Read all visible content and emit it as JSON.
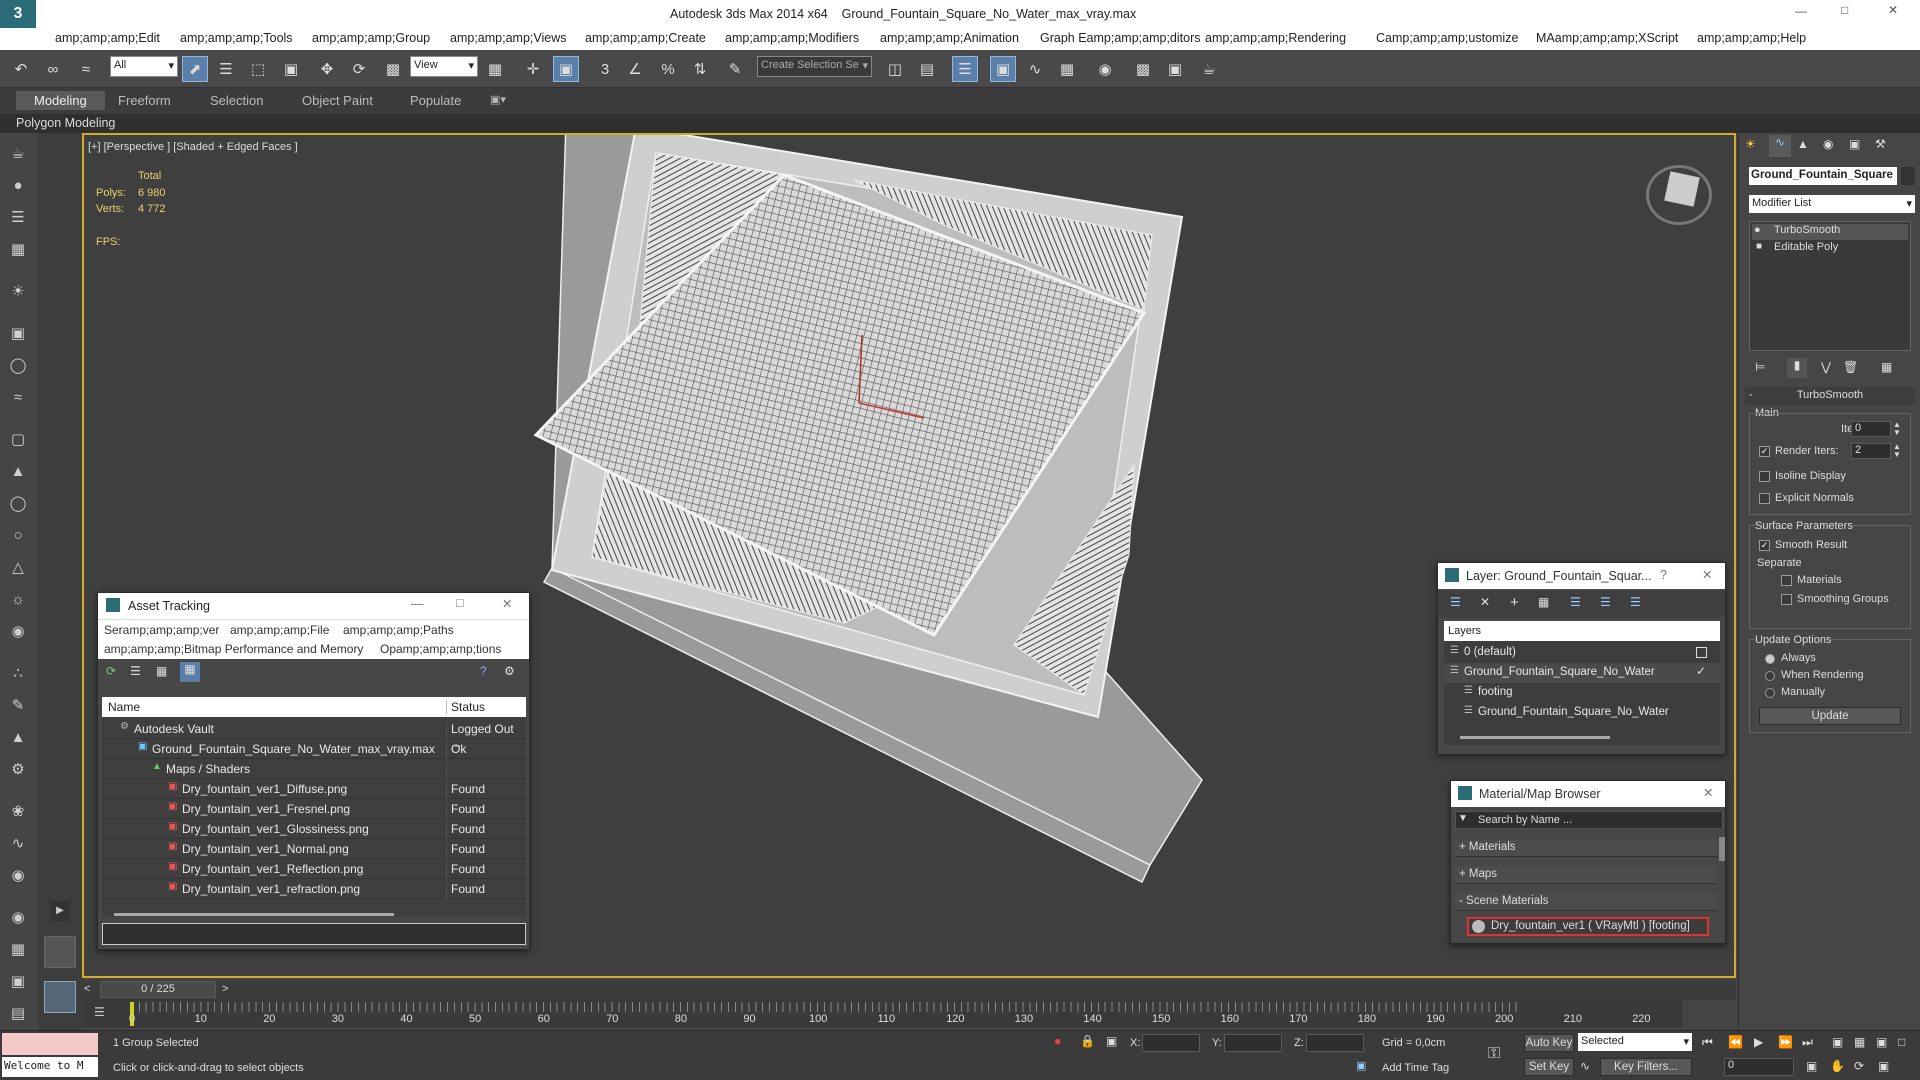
{
  "title": {
    "app": "Autodesk 3ds Max  2014 x64",
    "file": "Ground_Fountain_Square_No_Water_max_vray.max"
  },
  "menu": [
    "amp;amp;amp;Edit",
    "amp;amp;amp;Tools",
    "amp;amp;amp;Group",
    "amp;amp;amp;Views",
    "amp;amp;amp;Create",
    "amp;amp;amp;Modifiers",
    "amp;amp;amp;Animation",
    "Graph Eamp;amp;amp;ditors",
    "amp;amp;amp;Rendering",
    "Camp;amp;amp;ustomize",
    "MAamp;amp;amp;XScript",
    "amp;amp;amp;Help"
  ],
  "toolbar": {
    "filter": "All",
    "refcoord": "View",
    "selset": "Create Selection Se"
  },
  "ribbon": {
    "tabs": [
      "Modeling",
      "Freeform",
      "Selection",
      "Object Paint",
      "Populate"
    ],
    "sub": "Polygon Modeling"
  },
  "viewport": {
    "label": "[+] [Perspective ] [Shaded + Edged Faces ]",
    "stats_header": "Total",
    "polys_label": "Polys:",
    "polys": "6 980",
    "verts_label": "Verts:",
    "verts": "4 772",
    "fps_label": "FPS:"
  },
  "asset_tracking": {
    "title": "Asset Tracking",
    "menu1": [
      "Seramp;amp;amp;ver",
      "amp;amp;amp;File",
      "amp;amp;amp;Paths"
    ],
    "menu2": [
      "amp;amp;amp;Bitmap Performance and Memory",
      "Opamp;amp;amp;tions"
    ],
    "col_name": "Name",
    "col_status": "Status",
    "rows": [
      {
        "name": "Autodesk Vault",
        "status": "Logged Out ..."
      },
      {
        "name": "Ground_Fountain_Square_No_Water_max_vray.max",
        "status": "Ok"
      },
      {
        "name": "Maps / Shaders",
        "status": ""
      },
      {
        "name": "Dry_fountain_ver1_Diffuse.png",
        "status": "Found"
      },
      {
        "name": "Dry_fountain_ver1_Fresnel.png",
        "status": "Found"
      },
      {
        "name": "Dry_fountain_ver1_Glossiness.png",
        "status": "Found"
      },
      {
        "name": "Dry_fountain_ver1_Normal.png",
        "status": "Found"
      },
      {
        "name": "Dry_fountain_ver1_Reflection.png",
        "status": "Found"
      },
      {
        "name": "Dry_fountain_ver1_refraction.png",
        "status": "Found"
      }
    ]
  },
  "layer": {
    "title": "Layer: Ground_Fountain_Squar...",
    "header": "Layers",
    "rows": [
      "0 (default)",
      "Ground_Fountain_Square_No_Water",
      "footing",
      "Ground_Fountain_Square_No_Water"
    ]
  },
  "matbrowser": {
    "title": "Material/Map Browser",
    "search": "Search by Name ...",
    "sections": [
      "+ Materials",
      "+ Maps",
      "- Scene Materials"
    ],
    "item": "Dry_fountain_ver1 ( VRayMtl ) [footing]"
  },
  "cmdpanel": {
    "object": "Ground_Fountain_Square",
    "modlist": "Modifier List",
    "stack": [
      "TurboSmooth",
      "Editable Poly"
    ],
    "rollout": "TurboSmooth",
    "main": "Main",
    "iterations_label": "Iterations:",
    "iterations": "0",
    "render_label": "Render Iters:",
    "render": "2",
    "isoline": "Isoline Display",
    "explicit": "Explicit Normals",
    "surface": "Surface Parameters",
    "smooth": "Smooth Result",
    "separate": "Separate",
    "materials": "Materials",
    "smoothing": "Smoothing Groups",
    "update_opts": "Update Options",
    "always": "Always",
    "when": "When Rendering",
    "manual": "Manually",
    "update_btn": "Update"
  },
  "timeline": {
    "pos": "0 / 225",
    "ticks": [
      "0",
      "10",
      "20",
      "30",
      "40",
      "50",
      "60",
      "70",
      "80",
      "90",
      "100",
      "110",
      "120",
      "130",
      "140",
      "150",
      "160",
      "170",
      "180",
      "190",
      "200",
      "210",
      "220"
    ]
  },
  "status": {
    "welcome": "Welcome to M",
    "selected": "1 Group Selected",
    "prompt": "Click or click-and-drag to select objects",
    "x": "X:",
    "y": "Y:",
    "z": "Z:",
    "grid": "Grid = 0,0cm",
    "autokey": "Auto Key",
    "setkey": "Set Key",
    "keymode": "Selected",
    "keyfilters": "Key Filters...",
    "addtime": "Add Time Tag",
    "frame": "0"
  }
}
